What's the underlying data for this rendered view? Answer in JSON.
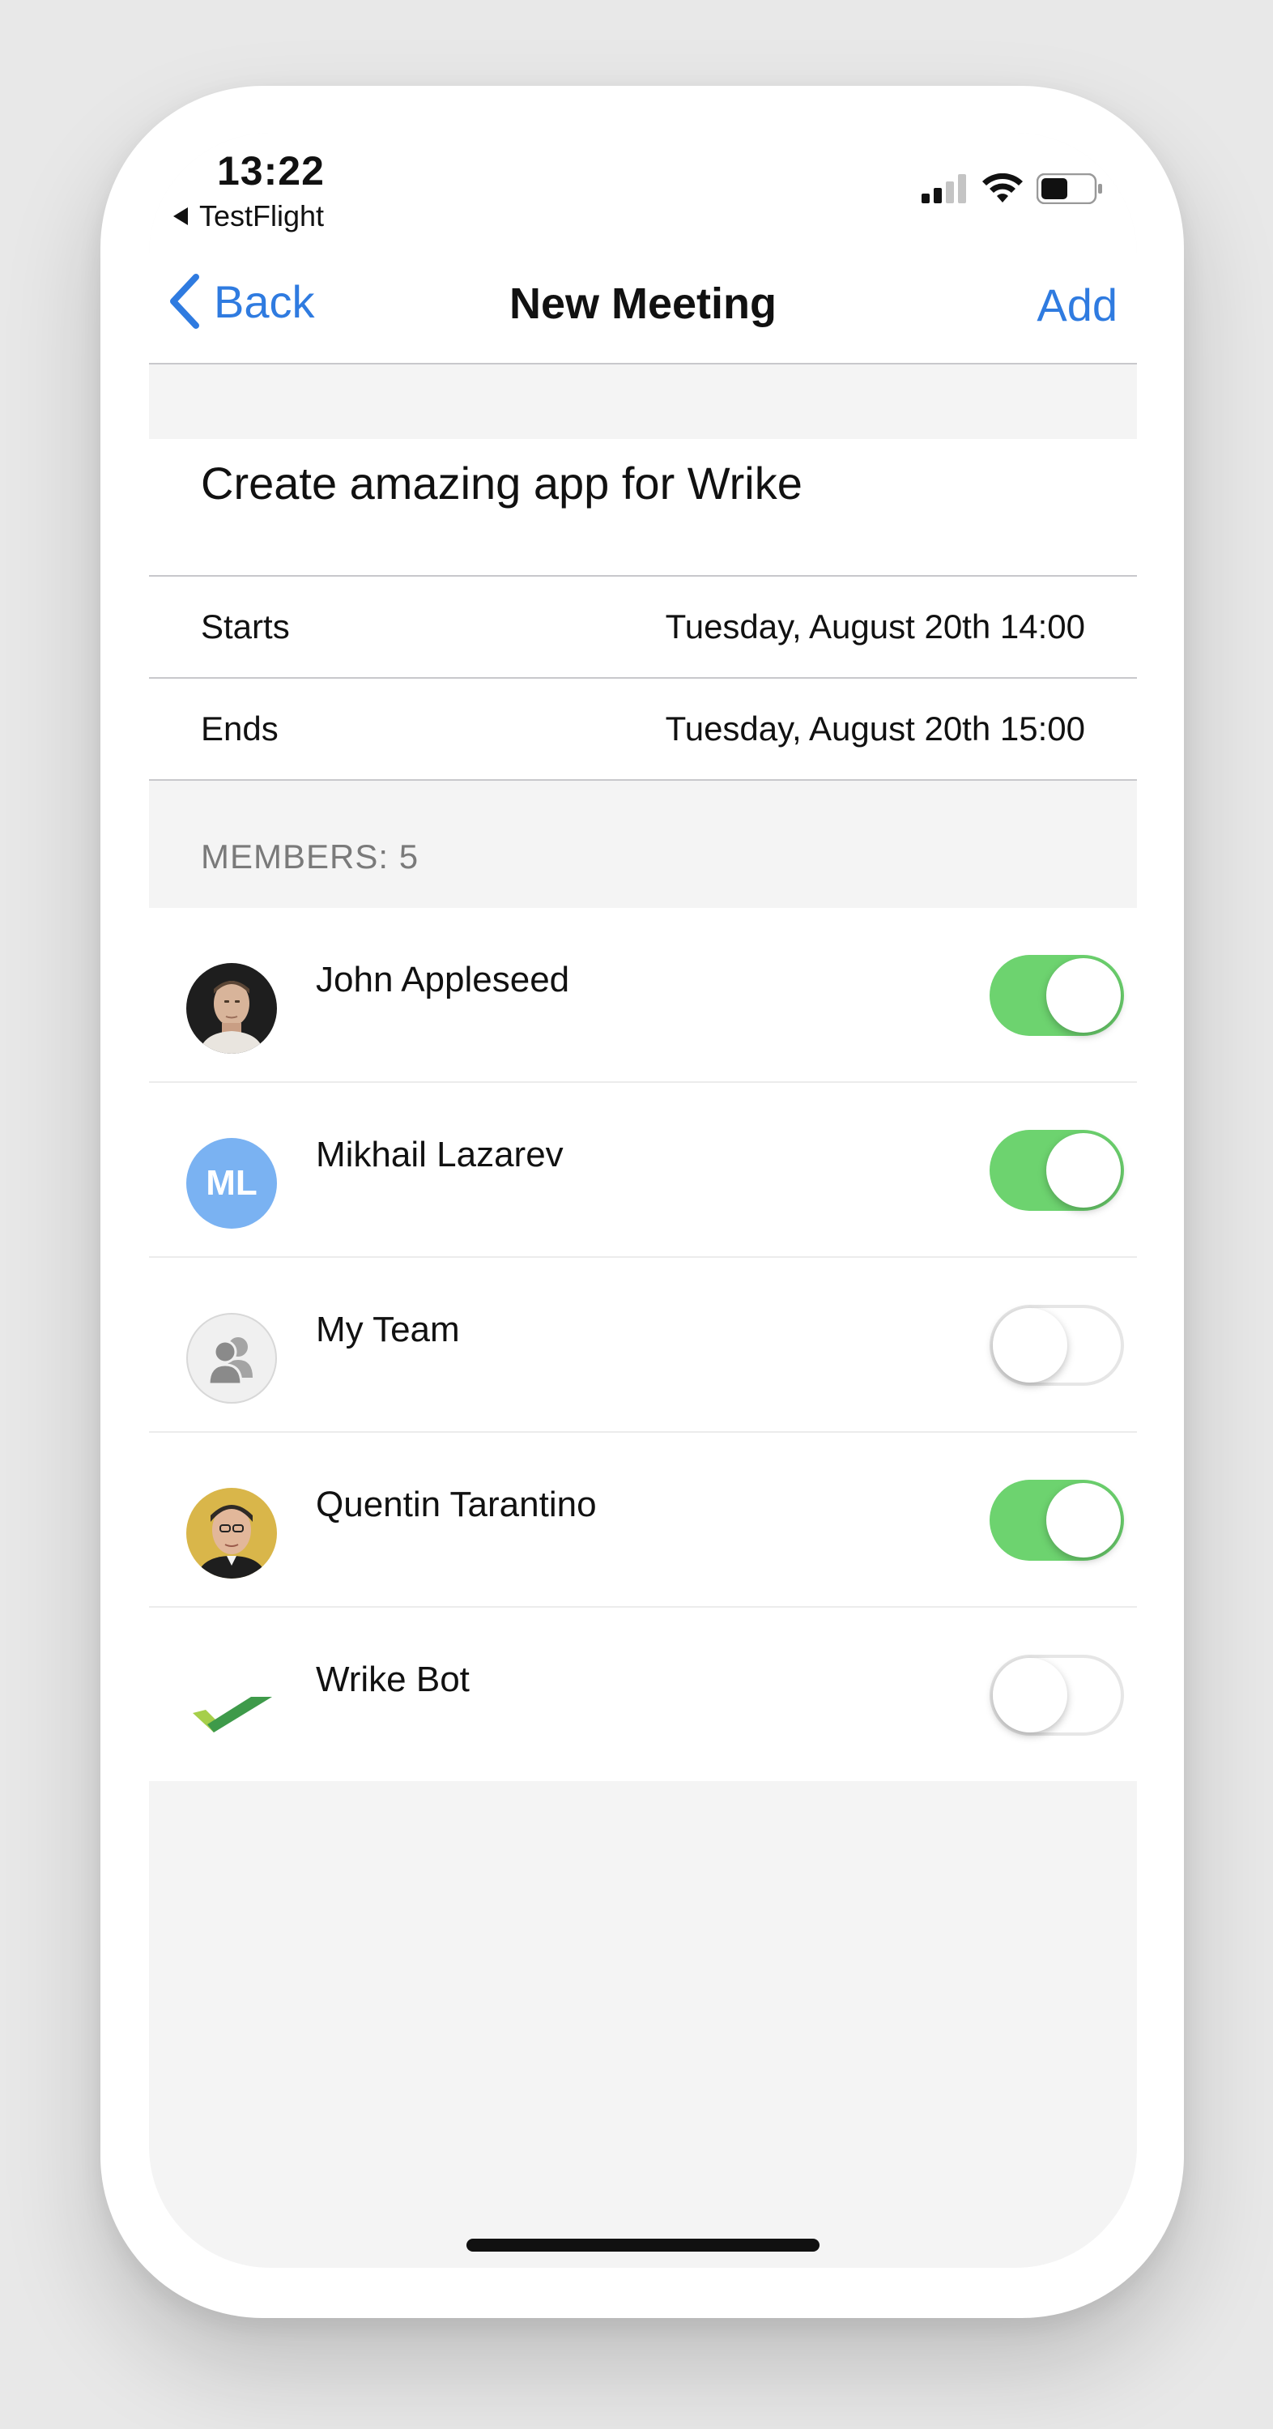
{
  "status_bar": {
    "time": "13:22",
    "back_app": "TestFlight"
  },
  "nav": {
    "back_label": "Back",
    "title": "New Meeting",
    "add_label": "Add"
  },
  "meeting": {
    "title": "Create amazing app for Wrike",
    "starts_label": "Starts",
    "starts_value": "Tuesday, August 20th 14:00",
    "ends_label": "Ends",
    "ends_value": "Tuesday, August 20th 15:00"
  },
  "members": {
    "header": "MEMBERS: 5",
    "items": [
      {
        "name": "John Appleseed",
        "avatar": "photo-avatar",
        "enabled": true
      },
      {
        "name": "Mikhail Lazarev",
        "avatar": "initials-avatar",
        "initials": "ML",
        "enabled": true
      },
      {
        "name": "My Team",
        "avatar": "team-icon",
        "enabled": false
      },
      {
        "name": "Quentin Tarantino",
        "avatar": "photo-avatar",
        "enabled": true
      },
      {
        "name": "Wrike Bot",
        "avatar": "wrike-logo-icon",
        "enabled": false
      }
    ]
  },
  "colors": {
    "accent": "#2f7be0",
    "toggle_on": "#6dd36f",
    "initials_bg": "#7ab2f2"
  }
}
